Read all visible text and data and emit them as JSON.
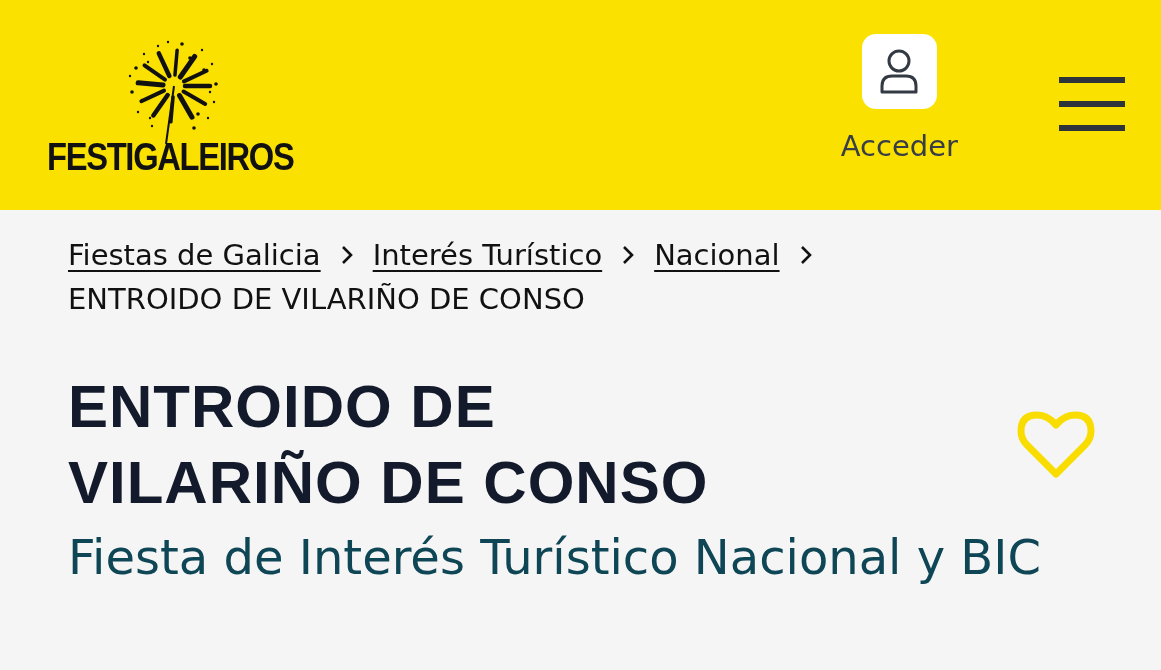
{
  "header": {
    "logo": {
      "text": "FESTIGALEIROS"
    },
    "account": {
      "label": "Acceder"
    }
  },
  "breadcrumbs": {
    "links": [
      "Fiestas de Galicia",
      "Interés Turístico",
      "Nacional"
    ],
    "current": "ENTROIDO DE VILARIÑO DE CONSO"
  },
  "event": {
    "title": "ENTROIDO DE VILARIÑO DE CONSO",
    "subtitle": "Fiesta de Interés Turístico Nacional y BIC"
  }
}
